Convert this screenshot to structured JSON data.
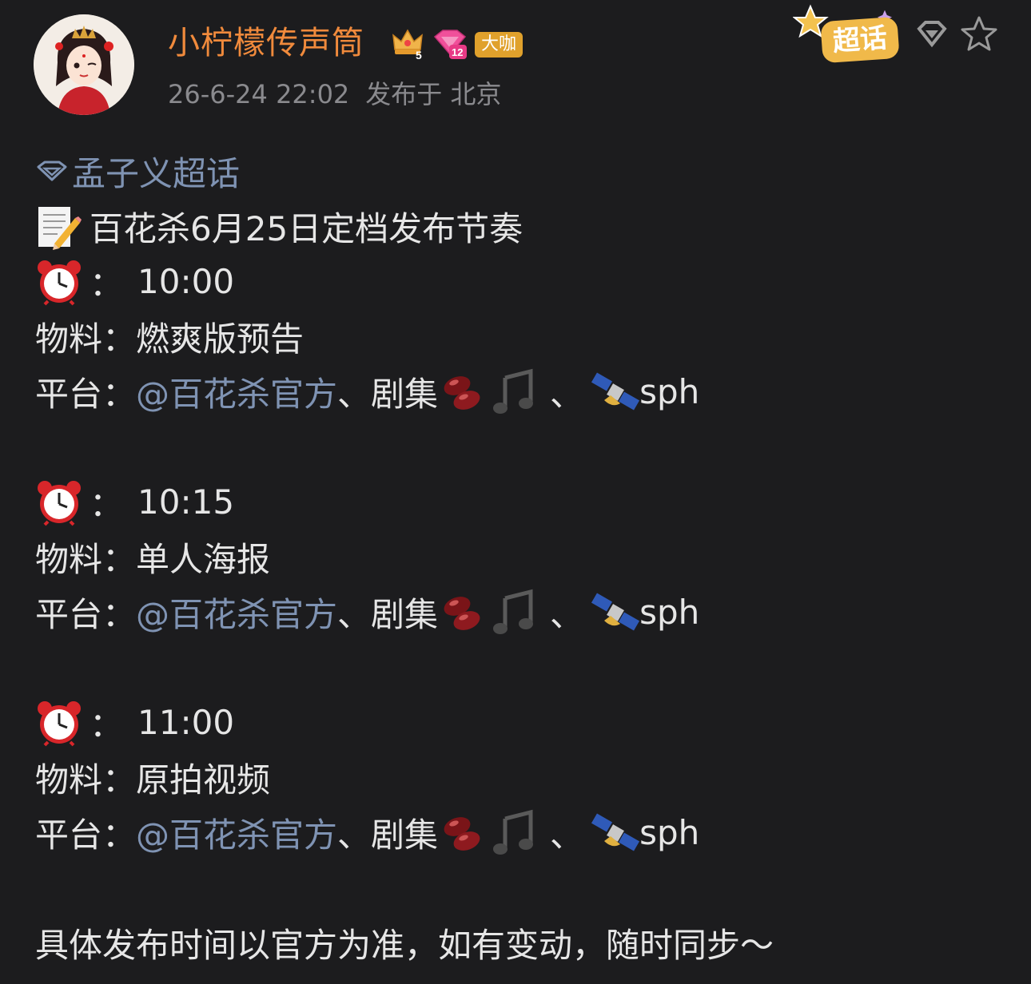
{
  "post": {
    "username": "小柠檬传声筒",
    "vip_badge": "大咖",
    "level": "12",
    "rank": "5",
    "time": "26-6-24 22:02",
    "location": "发布于 北京",
    "chaohua_label": "超话"
  },
  "content": {
    "topic": "孟子义超话",
    "headline": "百花杀6月25日定档发布节奏",
    "colon": "：",
    "schedules": [
      {
        "time": "10:00",
        "material_label": "物料：",
        "material": "燃爽版预告",
        "platform_label": "平台：",
        "platform_link": "@百花杀官方",
        "platform_rest": "、剧集",
        "sep": "、",
        "sph": "sph"
      },
      {
        "time": "10:15",
        "material_label": "物料：",
        "material": "单人海报",
        "platform_label": "平台：",
        "platform_link": "@百花杀官方",
        "platform_rest": "、剧集",
        "sep": "、",
        "sph": "sph"
      },
      {
        "time": "11:00",
        "material_label": "物料：",
        "material": "原拍视频",
        "platform_label": "平台：",
        "platform_link": "@百花杀官方",
        "platform_rest": "、剧集",
        "sep": "、",
        "sph": "sph"
      }
    ],
    "footer": "具体发布时间以官方为准，如有变动，随时同步～"
  },
  "icons": {
    "memo": "memo-icon",
    "clock": "alarm-clock-icon",
    "beans": "beans-icon",
    "music": "music-note-icon",
    "satellite": "satellite-icon",
    "star": "star-icon"
  },
  "colors": {
    "background": "#1c1c1e",
    "username": "#f08a3c",
    "link": "#7f93b3",
    "meta": "#8a8a8e",
    "vip": "#e0a12c"
  }
}
